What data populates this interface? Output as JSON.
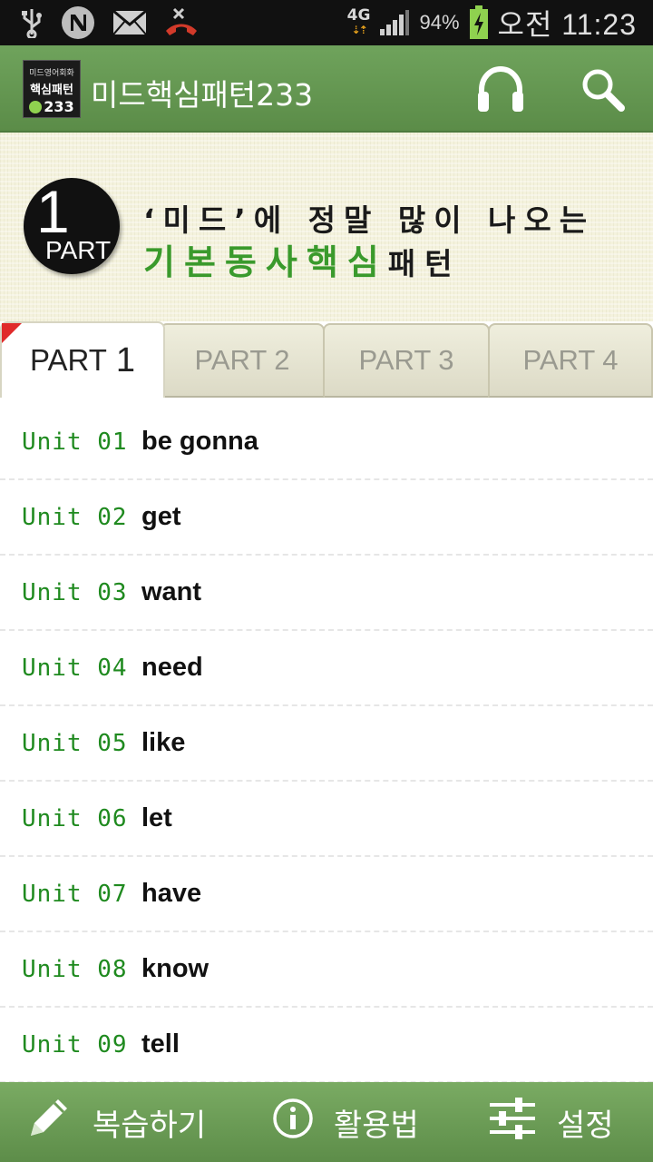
{
  "status_bar": {
    "network": "4G",
    "battery": "94%",
    "time": "오전 11:23"
  },
  "app_bar": {
    "logo": {
      "line1": "미드영어회화",
      "line2": "핵심패턴",
      "line3": "233"
    },
    "title": "미드핵심패턴233"
  },
  "banner": {
    "part_number": "1",
    "part_word": "PART",
    "line1": "‘미드’에 정말 많이 나오는",
    "line2_highlight": "기본동사핵심",
    "line2_rest": "패턴"
  },
  "tabs": [
    {
      "label": "PART",
      "number": "1"
    },
    {
      "label": "PART 2"
    },
    {
      "label": "PART 3"
    },
    {
      "label": "PART 4"
    }
  ],
  "units": [
    {
      "label": "Unit 01",
      "word": "be gonna"
    },
    {
      "label": "Unit 02",
      "word": "get"
    },
    {
      "label": "Unit 03",
      "word": "want"
    },
    {
      "label": "Unit 04",
      "word": "need"
    },
    {
      "label": "Unit 05",
      "word": "like"
    },
    {
      "label": "Unit 06",
      "word": "let"
    },
    {
      "label": "Unit 07",
      "word": "have"
    },
    {
      "label": "Unit 08",
      "word": "know"
    },
    {
      "label": "Unit 09",
      "word": "tell"
    }
  ],
  "bottom_bar": {
    "review": "복습하기",
    "howto": "활용법",
    "settings": "설정"
  },
  "colors": {
    "app_green": "#5b8c48",
    "unit_green": "#1f8a1f",
    "highlight_green": "#3a9a2c",
    "active_tab_mark": "#e02a2a"
  },
  "icons": [
    "usb-icon",
    "n-app-icon",
    "mail-icon",
    "missed-call-icon",
    "signal-icon",
    "battery-charging-icon",
    "headphones-icon",
    "search-icon",
    "pencil-icon",
    "info-icon",
    "sliders-icon"
  ]
}
